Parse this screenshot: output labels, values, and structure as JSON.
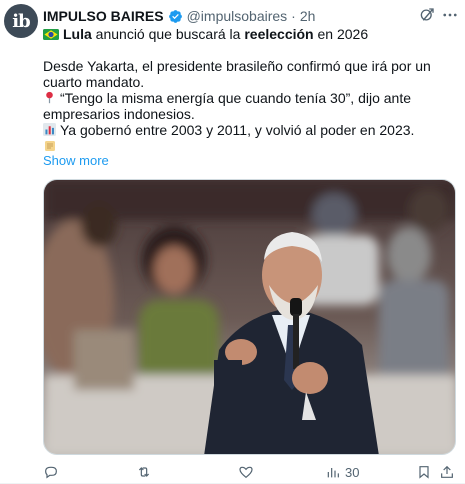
{
  "author": {
    "avatar_text": "ib",
    "name": "IMPULSO BAIRES",
    "handle": "@impulsobaires",
    "separator": "·",
    "time": "2h"
  },
  "tweet": {
    "headline_bold": "Lula",
    "headline_mid": " anunció que buscará la ",
    "headline_bold2": "reelección",
    "headline_end": " en 2026",
    "para1": "Desde Yakarta, el presidente brasileño confirmó que irá por un cuarto mandato.",
    "para2": "“Tengo la misma energía que cuando tenía 30”, dijo ante empresarios indonesios.",
    "para3": "Ya gobernó entre 2003 y 2011, y volvió al poder en 2023.",
    "show_more": "Show more"
  },
  "actions": {
    "views_count": "30"
  },
  "colors": {
    "accent": "#1d9bf0",
    "secondary_text": "#536471"
  }
}
